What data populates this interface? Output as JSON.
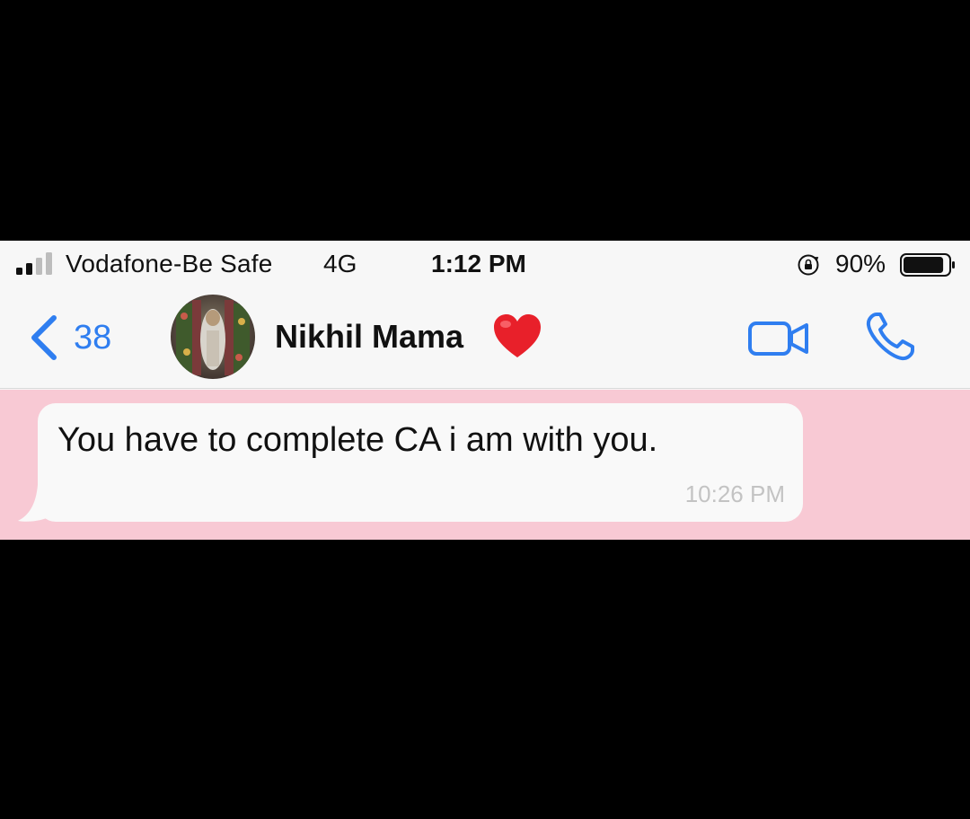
{
  "status_bar": {
    "carrier": "Vodafone-Be Safe",
    "network": "4G",
    "time": "1:12 PM",
    "battery_percent": "90%",
    "signal_bars_active": 2,
    "battery_level": 0.9
  },
  "nav": {
    "back_count": "38",
    "contact_name": "Nikhil Mama",
    "accent_color": "#2f7ef0"
  },
  "chat": {
    "background_color": "#f8c9d4",
    "messages": [
      {
        "text": "You have to complete CA i am with you.",
        "time": "10:26 PM",
        "direction": "incoming"
      }
    ]
  },
  "icons": {
    "back": "chevron-left-icon",
    "video": "video-camera-icon",
    "call": "phone-icon",
    "heart": "red-heart-emoji",
    "orientation_lock": "orientation-lock-icon",
    "battery": "battery-icon",
    "signal": "signal-strength-icon"
  }
}
